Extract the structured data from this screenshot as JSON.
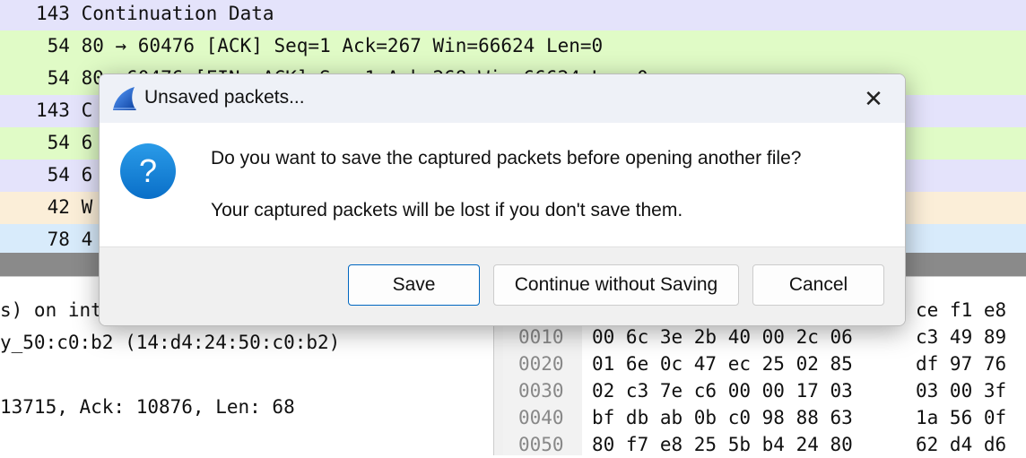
{
  "packet_list": {
    "rows": [
      {
        "text": "143 Continuation Data",
        "color": "#e4e3fb"
      },
      {
        "text": " 54 80 → 60476 [ACK] Seq=1 Ack=267 Win=66624 Len=0",
        "color": "#e0fbc6"
      },
      {
        "text": " 54 80",
        "color": "#e0fbc6"
      },
      {
        "text": "143 C",
        "color": "#e4e3fb"
      },
      {
        "text": " 54 6",
        "color": "#e0fbc6"
      },
      {
        "text": " 54 6",
        "color": "#e4e3fb"
      },
      {
        "text": " 42 W",
        "color": "#fbeed8"
      },
      {
        "text": " 78 4",
        "color": "#d8ebfb"
      }
    ]
  },
  "details": {
    "lines": [
      "s) on int",
      "y_50:c0:b2 (14:d4:24:50:c0:b2)",
      "",
      "13715, Ack: 10876, Len: 68"
    ]
  },
  "hex": {
    "partial_first": "ce f1 e8",
    "rows": [
      {
        "offset": "0010",
        "a": "00 6c 3e 2b 40 00 2c 06",
        "b": "c3 49 89"
      },
      {
        "offset": "0020",
        "a": "01 6e 0c 47 ec 25 02 85",
        "b": "df 97 76"
      },
      {
        "offset": "0030",
        "a": "02 c3 7e c6 00 00 17 03",
        "b": "03 00 3f"
      },
      {
        "offset": "0040",
        "a": "bf db ab 0b c0 98 88 63",
        "b": "1a 56 0f"
      },
      {
        "offset": "0050",
        "a": "80 f7 e8 25 5b b4 24 80",
        "b": "62 d4 d6"
      }
    ]
  },
  "dialog": {
    "title": "Unsaved packets...",
    "app_icon": "wireshark-fin-icon",
    "message_icon": "question-icon",
    "message": "Do you want to save the captured packets before opening another file?",
    "detail": "Your captured packets will be lost if you don't save them.",
    "buttons": {
      "save": "Save",
      "continue": "Continue without Saving",
      "cancel": "Cancel"
    },
    "accent": "#0067c0"
  }
}
